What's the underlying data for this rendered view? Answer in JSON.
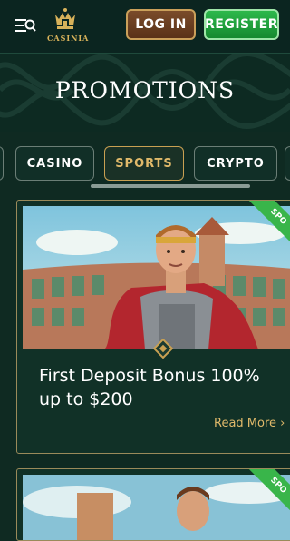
{
  "header": {
    "logo_text": "CASINIA",
    "login_label": "LOG IN",
    "register_label": "REGISTER"
  },
  "page": {
    "title": "PROMOTIONS"
  },
  "tabs": [
    {
      "label": "CASINO",
      "active": false
    },
    {
      "label": "SPORTS",
      "active": true
    },
    {
      "label": "CRYPTO",
      "active": false
    }
  ],
  "promotions": [
    {
      "badge": "SPO",
      "title": "First Deposit Bonus 100% up to $200",
      "cta": "Read More",
      "cta_icon": "chevron-right-icon"
    },
    {
      "badge": "SPO"
    }
  ],
  "colors": {
    "background": "#0f2a22",
    "accent_gold": "#e0b96a",
    "register_green": "#2db84b",
    "login_brown": "#7a4b2a",
    "badge_green": "#39b54a"
  }
}
